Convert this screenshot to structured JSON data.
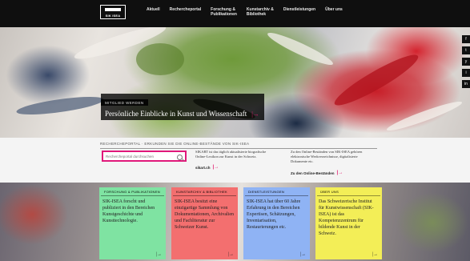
{
  "header": {
    "logo_text": "SIK ISEA",
    "nav": [
      {
        "label": "Aktuell"
      },
      {
        "label": "Recherche­portal"
      },
      {
        "label": "Forschung &\nPublikationen"
      },
      {
        "label": "Kunstarchiv &\nBibliothek"
      },
      {
        "label": "Dienstleistungen"
      },
      {
        "label": "Über uns"
      }
    ]
  },
  "hero": {
    "kicker": "Mitglied werden",
    "title": "Persönliche Einblicke in Kunst und Wissenschaft",
    "arrow": "|→"
  },
  "social": {
    "icons": [
      "f",
      "t",
      "y",
      "i",
      "in"
    ]
  },
  "search": {
    "heading": "Rechercheportal · Erkunden Sie die Online-Bestände von SIK-ISEA",
    "placeholder": "Rechercheportal durchsuchen",
    "col1_text": "SIKART ist das täglich aktualisierte biografische Online-Lexikon zur Kunst in der Schweiz.",
    "col1_link": "sikart.ch",
    "col2_text": "Zu den Online-Beständen von SIK-ISEA gehören elektronische Werkverzeichnisse, digitalisierte Dokumente etc.",
    "col2_link": "Zu den Online-Beständen",
    "arrow": "|→"
  },
  "cards": [
    {
      "head": "Forschung & Publikationen",
      "body": "SIK-ISEA forscht und publiziert in den Bereichen Kunstgeschichte und Kunsttechnologie.",
      "color": "#7fe3a2"
    },
    {
      "head": "Kunstarchiv & Bibliothek",
      "body": "SIK-ISEA besitzt eine einzigartige Sammlung von Dokumentationen, Archivalien und Fachliteratur zur Schweizer Kunst.",
      "color": "#f36f6f"
    },
    {
      "head": "Dienstleistungen",
      "body": "SIK-ISEA hat über 60 Jahre Erfahrung in den Bereichen Expertisen, Schätzungen, Inventarisation, Restaurierungen etc.",
      "color": "#8fb3f4"
    },
    {
      "head": "Über uns",
      "body": "Das Schweizerische Institut für Kunstwissenschaft (SIK-ISEA) ist das Kompetenzzentrum für bildende Kunst in der Schweiz.",
      "color": "#f3ee57"
    }
  ],
  "card_arrow": "|→"
}
